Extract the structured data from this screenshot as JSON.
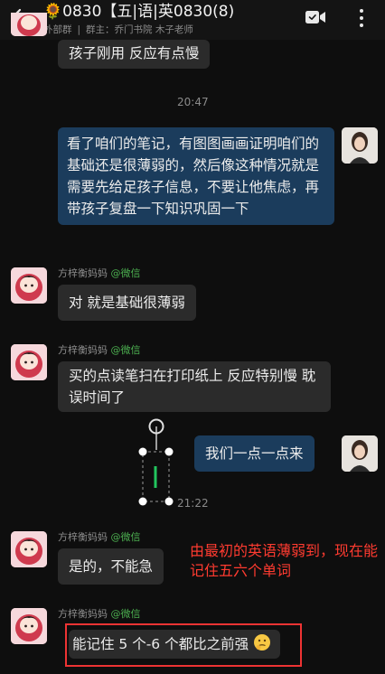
{
  "header": {
    "title_emoji": "🌻",
    "title": "0830【五|语|英0830(8)",
    "group_tag": "外部群",
    "group_info": "群主：乔门书院 木子老师"
  },
  "messages": {
    "m0_text": "孩子刚用 反应有点慢",
    "time_2047": "20:47",
    "m1_text": "看了咱们的笔记，有图图画画证明咱们的基础还是很薄弱的，然后像这种情况就是需要先给足孩子信息，不要让他焦虑，再带孩子复盘一下知识巩固一下",
    "sender_name": "方梓衡妈妈",
    "sender_tag": "@微信",
    "m2_text": "对 就是基础很薄弱",
    "m3_text": "买的点读笔扫在打印纸上 反应特别慢 耽误时间了",
    "m4_text": "我们一点一点来",
    "time_2122": "21:22",
    "m5_text": "是的，不能急",
    "m6_text": "能记住 5 个-6 个都比之前强"
  },
  "annotation": "由最初的英语薄弱到，现在能记住五六个单词",
  "colors": {
    "background": "#0e0e0e",
    "left_bubble": "#2b2b2b",
    "right_bubble": "#1b3c5c",
    "annotation": "#ff3b30",
    "highlight_border": "#ee3333",
    "wechat_tag": "#4caf50",
    "sound_bar": "#22c55e"
  },
  "icons": {
    "back": "back-arrow-icon",
    "video": "video-call-icon",
    "more": "more-vertical-icon",
    "thinking": "thinking-face-emoji-icon"
  }
}
